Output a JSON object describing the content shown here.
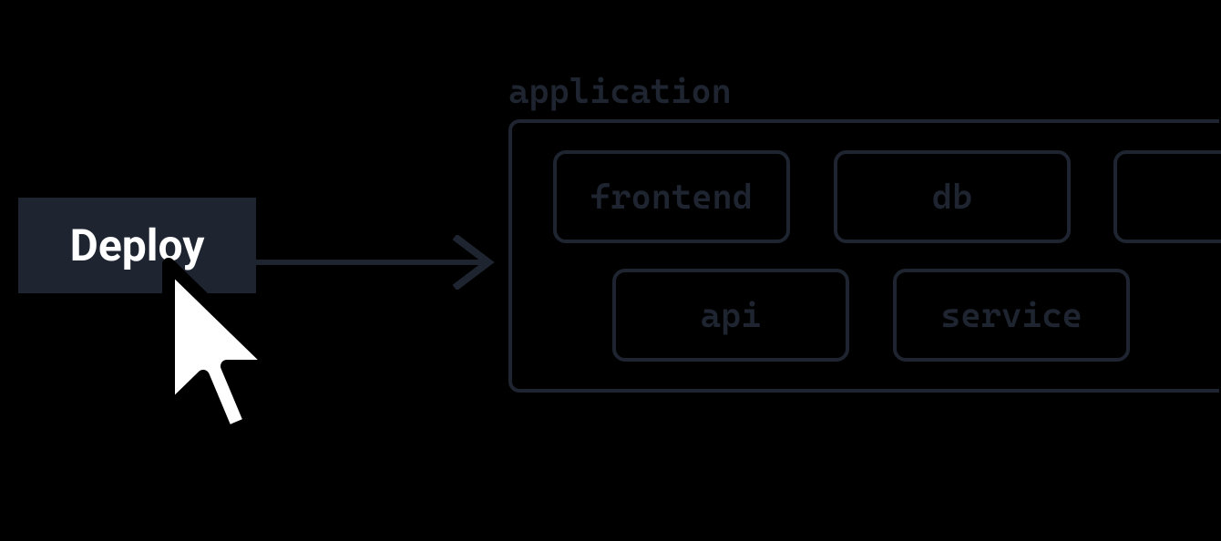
{
  "button": {
    "label": "Deploy"
  },
  "container": {
    "label": "application"
  },
  "components": {
    "frontend": "frontend",
    "db": "db",
    "api": "api",
    "service": "service"
  }
}
